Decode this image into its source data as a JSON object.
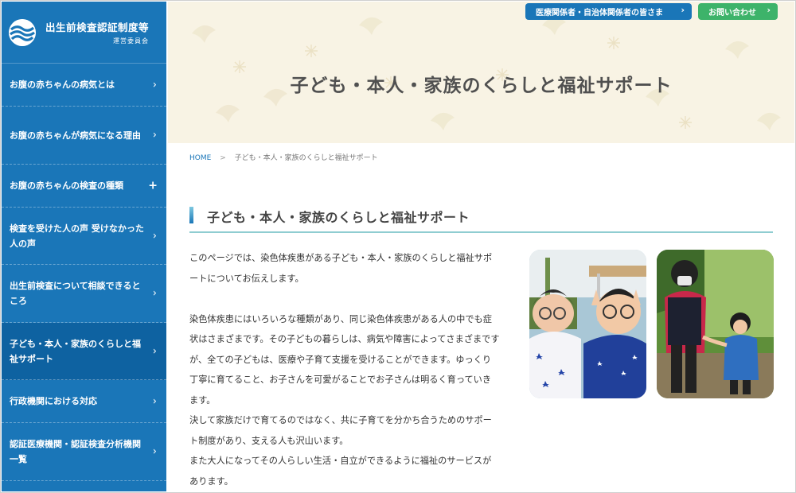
{
  "sidebar": {
    "logo_title": "出生前検査認証制度等",
    "logo_sub": "運営委員会",
    "items": [
      {
        "label": "お腹の赤ちゃんの病気とは",
        "marker": "›"
      },
      {
        "label": "お腹の赤ちゃんが病気になる理由",
        "marker": "›"
      },
      {
        "label": "お腹の赤ちゃんの検査の種類",
        "marker": "+"
      },
      {
        "label": "検査を受けた人の声 受けなかった人の声",
        "marker": "›"
      },
      {
        "label": "出生前検査について相談できるところ",
        "marker": "›"
      },
      {
        "label": "子ども・本人・家族のくらしと福祉サポート",
        "marker": "›"
      },
      {
        "label": "行政機関における対応",
        "marker": "›"
      },
      {
        "label": "認証医療機関・認証検査分析機関一覧",
        "marker": "›"
      }
    ]
  },
  "header": {
    "medical_button": "医療関係者・自治体関係者の皆さま",
    "contact_button": "お問い合わせ",
    "chevron": "›",
    "hero_title": "子ども・本人・家族のくらしと福祉サポート"
  },
  "breadcrumb": {
    "home": "HOME",
    "separator": ">",
    "current": "子ども・本人・家族のくらしと福祉サポート"
  },
  "main": {
    "section_title": "子ども・本人・家族のくらしと福祉サポート",
    "paragraphs": {
      "p1": "このページでは、染色体疾患がある子ども・本人・家族のくらしと福祉サポートについてお伝えします。",
      "p2": "染色体疾患にはいろいろな種類があり、同じ染色体疾患がある人の中でも症状はさまざまです。その子どもの暮らしは、病気や障害によってさまざまですが、全ての子どもは、医療や子育て支援を受けることができます。ゆっくり丁寧に育てること、お子さんを可愛がることでお子さんは明るく育っていきます。",
      "p3": "決して家族だけで育てるのではなく、共に子育てを分かち合うためのサポート制度があり、支える人も沢山います。",
      "p4": "また大人になってその人らしい生活・自立ができるように福祉のサービスがあります。"
    }
  },
  "colors": {
    "sidebar_bg": "#1a76b8",
    "sidebar_active": "#0e62a1",
    "medical_button": "#1a76b8",
    "contact_button": "#3db36a",
    "hero_bg": "#f8f3e4",
    "section_underline": "#8fcdd1"
  },
  "icons": {
    "logo": "wave-globe-icon",
    "nav_arrow": "chevron-right-icon",
    "nav_expand": "plus-icon"
  }
}
